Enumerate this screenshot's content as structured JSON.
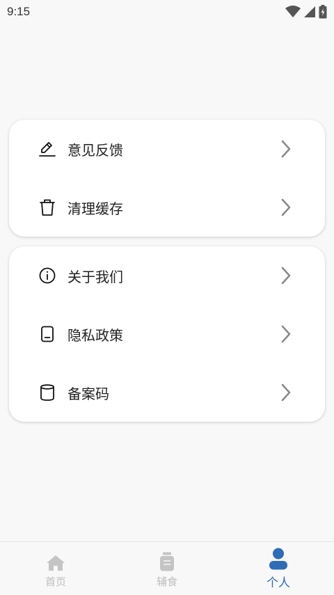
{
  "status_bar": {
    "time": "9:15"
  },
  "cards": [
    {
      "items": [
        {
          "label": "意见反馈",
          "icon": "edit-icon"
        },
        {
          "label": "清理缓存",
          "icon": "trash-icon"
        }
      ]
    },
    {
      "items": [
        {
          "label": "关于我们",
          "icon": "info-icon"
        },
        {
          "label": "隐私政策",
          "icon": "document-icon"
        },
        {
          "label": "备案码",
          "icon": "cylinder-icon"
        }
      ]
    }
  ],
  "bottom_nav": {
    "items": [
      {
        "label": "首页",
        "icon": "home-icon",
        "active": false
      },
      {
        "label": "辅食",
        "icon": "food-jar-icon",
        "active": false
      },
      {
        "label": "个人",
        "icon": "person-icon",
        "active": true
      }
    ]
  },
  "colors": {
    "background": "#f8f8f8",
    "card": "#ffffff",
    "active_nav": "#2e6cb5",
    "inactive_nav": "#bdbdbd",
    "chevron": "#8a8a8a"
  }
}
